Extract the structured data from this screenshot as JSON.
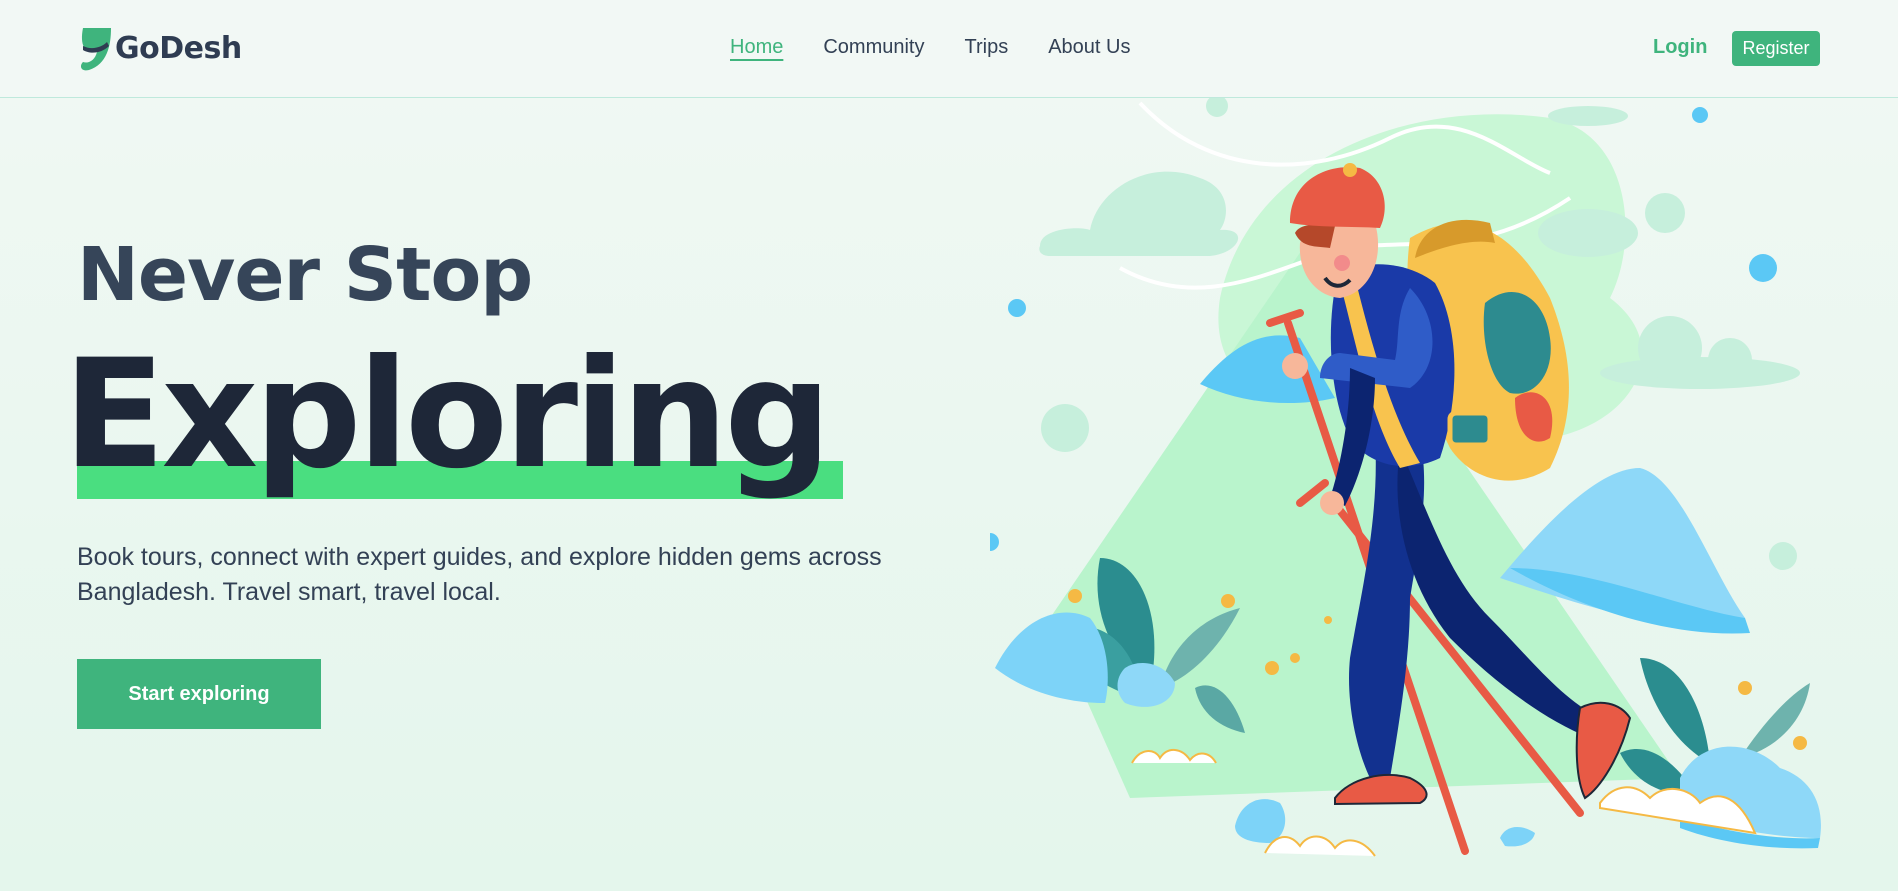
{
  "brand": {
    "name": "GoDesh"
  },
  "nav": {
    "items": [
      {
        "label": "Home",
        "active": true
      },
      {
        "label": "Community",
        "active": false
      },
      {
        "label": "Trips",
        "active": false
      },
      {
        "label": "About Us",
        "active": false
      }
    ]
  },
  "auth": {
    "login_label": "Login",
    "register_label": "Register"
  },
  "hero": {
    "line1": "Never Stop",
    "line2": "Exploring",
    "description": "Book tours, connect with expert guides, and explore hidden gems across Bangladesh. Travel smart, travel local.",
    "cta_label": "Start exploring"
  },
  "colors": {
    "accent": "#3fb47d",
    "highlight": "#4ade80",
    "heading_dark": "#1e2738",
    "heading": "#364559"
  },
  "illustration": {
    "subject": "hiker-with-backpack-and-trekking-poles"
  }
}
